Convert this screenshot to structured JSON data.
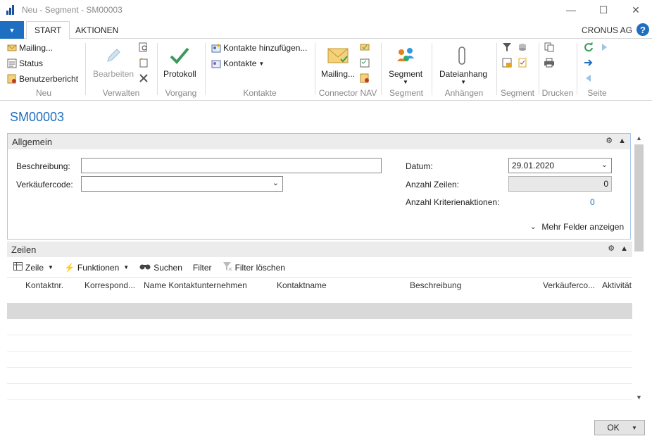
{
  "window": {
    "title": "Neu - Segment - SM00003",
    "minimize": "—",
    "maximize": "☐",
    "close": "✕"
  },
  "tabs": [
    {
      "label": "START"
    },
    {
      "label": "AKTIONEN"
    }
  ],
  "company": "CRONUS AG",
  "help_glyph": "?",
  "ribbon": {
    "neu": {
      "label": "Neu",
      "mailing": "Mailing...",
      "status": "Status",
      "benutzerbericht": "Benutzerbericht"
    },
    "verwalten": {
      "label": "Verwalten",
      "bearbeiten": "Bearbeiten"
    },
    "vorgang": {
      "label": "Vorgang",
      "protokoll": "Protokoll"
    },
    "kontakte": {
      "label": "Kontakte",
      "hinzufuegen": "Kontakte hinzufügen...",
      "kontakte": "Kontakte"
    },
    "connector": {
      "label": "Connector NAV",
      "mailing": "Mailing..."
    },
    "segment": {
      "label": "Segment",
      "segment": "Segment"
    },
    "anhaengen": {
      "label": "Anhängen",
      "dateianhang": "Dateianhang"
    },
    "segment2": {
      "label": "Segment"
    },
    "drucken": {
      "label": "Drucken"
    },
    "seite": {
      "label": "Seite"
    }
  },
  "page_title": "SM00003",
  "allgemein": {
    "title": "Allgemein",
    "beschreibung_label": "Beschreibung:",
    "beschreibung_value": "",
    "verkaeufercode_label": "Verkäufercode:",
    "verkaeufercode_value": "",
    "datum_label": "Datum:",
    "datum_value": "29.01.2020",
    "anzahl_zeilen_label": "Anzahl Zeilen:",
    "anzahl_zeilen_value": "0",
    "anzahl_kriterien_label": "Anzahl Kriterienaktionen:",
    "anzahl_kriterien_value": "0",
    "mehr_felder": "Mehr Felder anzeigen"
  },
  "zeilen": {
    "title": "Zeilen",
    "toolbar": {
      "zeile": "Zeile",
      "funktionen": "Funktionen",
      "suchen": "Suchen",
      "filter": "Filter",
      "filter_loeschen": "Filter löschen"
    },
    "columns": [
      "Kontaktnr.",
      "Korrespond...",
      "Name Kontaktunternehmen",
      "Kontaktname",
      "Beschreibung",
      "Verkäuferco...",
      "Aktivität"
    ]
  },
  "ok_label": "OK",
  "colors": {
    "accent": "#1e6fc1",
    "green": "#3a9a5b",
    "border_blue": "#a9c7ea"
  }
}
